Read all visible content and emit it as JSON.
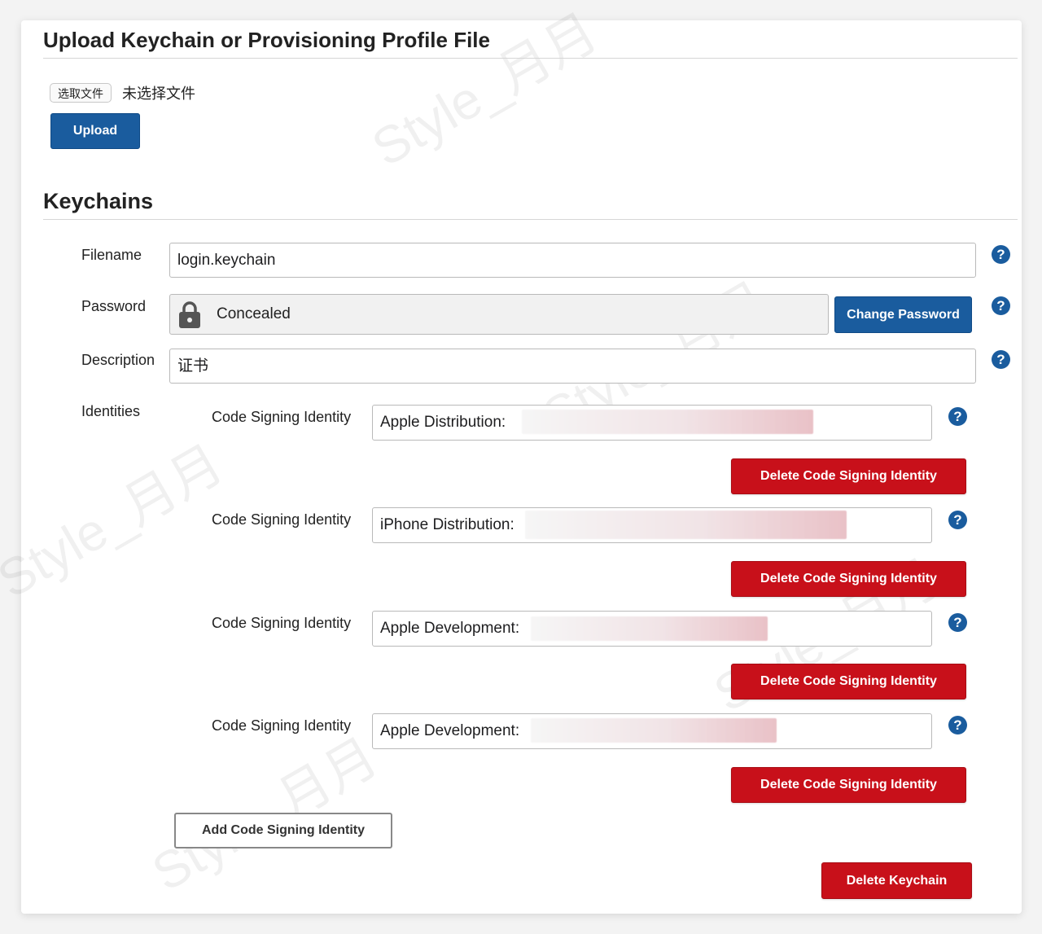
{
  "upload_section": {
    "title": "Upload Keychain or Provisioning Profile File",
    "choose_file_label": "选取文件",
    "file_status": "未选择文件",
    "upload_button": "Upload"
  },
  "keychains": {
    "title": "Keychains",
    "filename_label": "Filename",
    "filename_value": "login.keychain",
    "password_label": "Password",
    "password_value": "Concealed",
    "change_password_button": "Change Password",
    "description_label": "Description",
    "description_value": "证书",
    "identities_label": "Identities",
    "identities": [
      {
        "label": "Code Signing Identity",
        "value": "Apple Distribution: ",
        "delete_label": "Delete Code Signing Identity"
      },
      {
        "label": "Code Signing Identity",
        "value": "iPhone Distribution:",
        "delete_label": "Delete Code Signing Identity"
      },
      {
        "label": "Code Signing Identity",
        "value": "Apple Development:",
        "delete_label": "Delete Code Signing Identity"
      },
      {
        "label": "Code Signing Identity",
        "value": "Apple Development:",
        "delete_label": "Delete Code Signing Identity"
      }
    ],
    "add_identity_button": "Add Code Signing Identity",
    "delete_keychain_button": "Delete Keychain",
    "help_symbol": "?"
  },
  "watermark_text": "Style_月月",
  "colors": {
    "primary_blue": "#1a5c9e",
    "danger_red": "#c8101a"
  },
  "icons": [
    "lock-icon",
    "help-icon"
  ]
}
